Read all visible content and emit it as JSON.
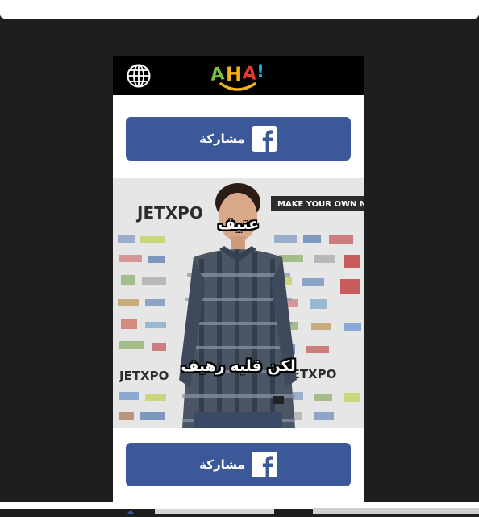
{
  "top_bar": {
    "icons": [
      "home-icon",
      "chat-icon",
      "grid-icon"
    ]
  },
  "card": {
    "header": {
      "logo_text": "AHA!",
      "globe_icon": "globe-icon"
    },
    "share_button_top": {
      "label": "مشاركة",
      "icon": "facebook-icon"
    },
    "photo": {
      "caption_top": "عنيف",
      "caption_bottom": "لكن قلبه رهيف",
      "backdrop_text_1": "JETXPO",
      "backdrop_text_2": "MAKE YOUR OWN MOVE"
    },
    "share_button_bottom": {
      "label": "مشاركة",
      "icon": "facebook-icon"
    }
  },
  "colors": {
    "background": "#1e1e1e",
    "facebook_blue": "#3b5998",
    "header_black": "#000000"
  }
}
